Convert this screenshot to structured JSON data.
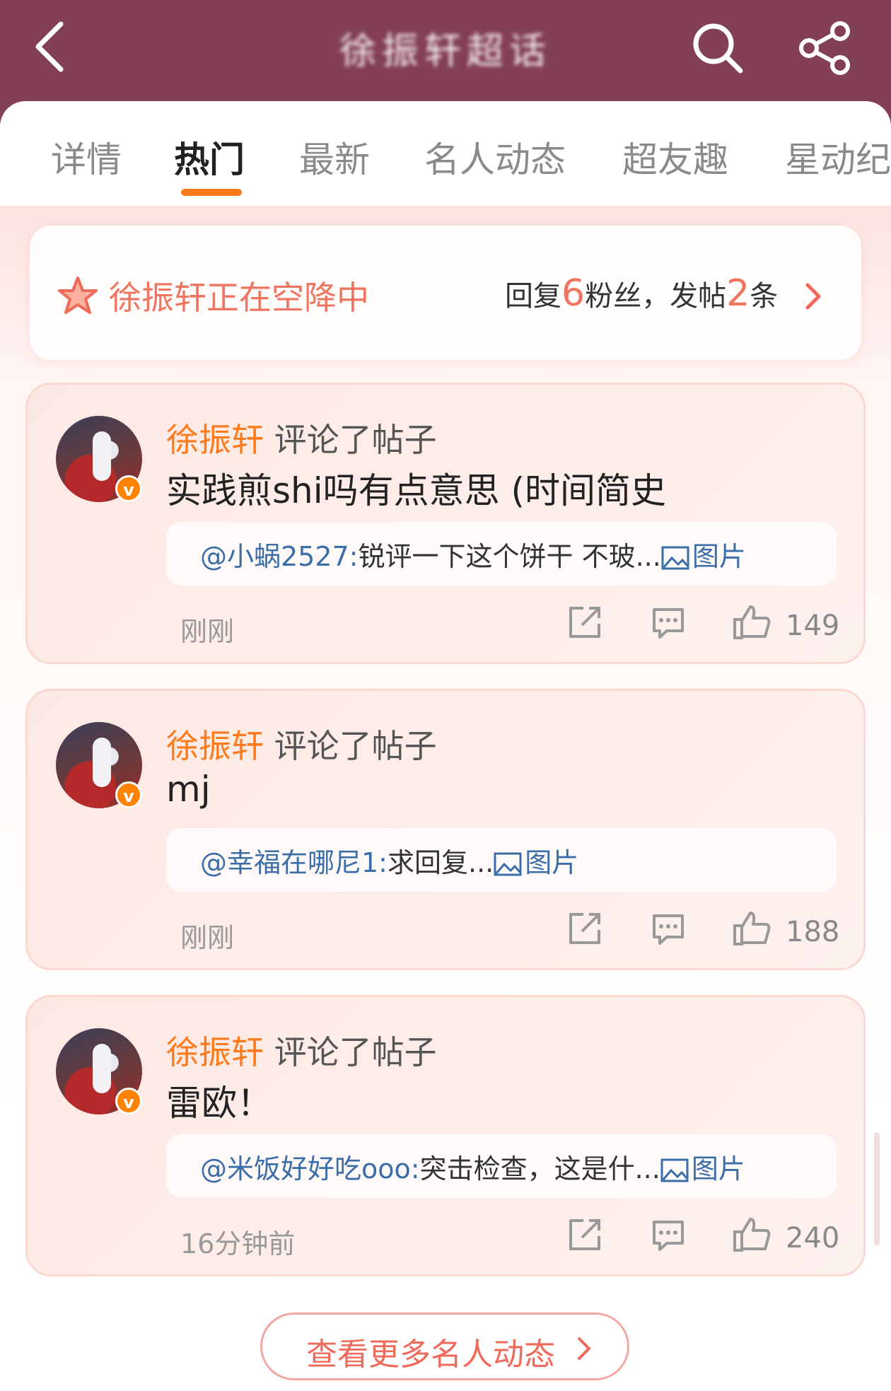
{
  "header": {
    "title": "徐振轩超话",
    "back_icon": "chevron-left-icon",
    "search_icon": "search-icon",
    "share_icon": "share-icon"
  },
  "tabs": [
    {
      "label": "详情",
      "active": false
    },
    {
      "label": "热门",
      "active": true
    },
    {
      "label": "最新",
      "active": false
    },
    {
      "label": "名人动态",
      "active": false
    },
    {
      "label": "超友趣",
      "active": false
    },
    {
      "label": "星动纪",
      "active": false
    }
  ],
  "airdrop": {
    "label": "徐振轩正在空降中",
    "stats_prefix": "回复",
    "fans_count": "6",
    "stats_middle": "粉丝，发帖",
    "posts_count": "2",
    "stats_suffix": "条"
  },
  "posts": [
    {
      "user": "徐振轩",
      "action": "评论了帖子",
      "text": "实践煎shi吗有点意思 (时间简史",
      "quote_mention": "@小蜗2527:",
      "quote_text": "锐评一下这个饼干 不玻...",
      "quote_pic_label": "图片",
      "time": "刚刚",
      "likes": "149"
    },
    {
      "user": "徐振轩",
      "action": "评论了帖子",
      "text": "mj",
      "quote_mention": "@幸福在哪尼1:",
      "quote_text": "求回复...",
      "quote_pic_label": "图片",
      "time": "刚刚",
      "likes": "188"
    },
    {
      "user": "徐振轩",
      "action": "评论了帖子",
      "text": "雷欧！",
      "quote_mention": "@米饭好好吃ooo:",
      "quote_text": "突击检查，这是什...",
      "quote_pic_label": "图片",
      "time": "16分钟前",
      "likes": "240"
    }
  ],
  "more_button": {
    "label": "查看更多名人动态"
  },
  "colors": {
    "header_bg": "#833f54",
    "accent_orange": "#ff7a1a",
    "accent_coral": "#ef7560",
    "mention_blue": "#3b6ea8",
    "verified_badge": "#ff8200"
  }
}
